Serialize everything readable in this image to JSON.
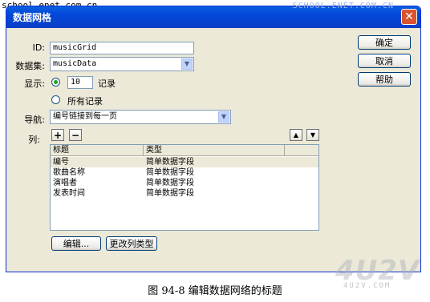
{
  "watermark": {
    "top_left": "school.enet.com.cn",
    "top_right": "SCHOOL.ENET.COM.CN",
    "logo": "4U2V",
    "logo_sub": "4U2V.COM"
  },
  "dialog": {
    "title": "数据网格",
    "close_label": "✕",
    "id_label": "ID:",
    "id_value": "musicGrid",
    "dataset_label": "数据集:",
    "dataset_value": "musicData",
    "show_label": "显示:",
    "show_count": "10",
    "records_label": "记录",
    "all_records_label": "所有记录",
    "nav_label": "导航:",
    "nav_value": "编号链接到每一页",
    "columns_label": "列:",
    "add_label": "+",
    "remove_label": "−",
    "up_label": "▲",
    "down_label": "▼",
    "buttons": {
      "ok": "确定",
      "cancel": "取消",
      "help": "帮助"
    },
    "table": {
      "headers": [
        "标题",
        "类型"
      ],
      "rows": [
        [
          "编号",
          "简单数据字段"
        ],
        [
          "歌曲名称",
          "简单数据字段"
        ],
        [
          "演唱者",
          "简单数据字段"
        ],
        [
          "发表时间",
          "简单数据字段"
        ]
      ]
    },
    "edit_label": "编辑...",
    "change_type_label": "更改列类型"
  },
  "caption": "图 94-8    编辑数据网络的标题"
}
